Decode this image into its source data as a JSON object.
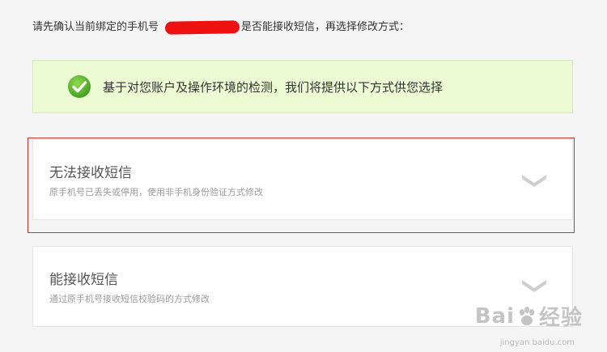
{
  "intro": {
    "before": "请先确认当前绑定的手机号",
    "after": "是否能接收短信，再选择修改方式："
  },
  "notice": {
    "icon": "check-circle-icon",
    "text": "基于对您账户及操作环境的检测，我们将提供以下方式供您选择"
  },
  "options": [
    {
      "title": "无法接收短信",
      "desc": "原手机号已丢失或停用，使用非手机身份验证方式修改",
      "icon": "chevron-down-icon"
    },
    {
      "title": "能接收短信",
      "desc": "通过原手机号接收短信校验码的方式修改",
      "icon": "chevron-down-icon"
    }
  ],
  "colors": {
    "notice_bg": "#ecfbd4",
    "check_green": "#5cb82e",
    "highlight_border": "#cc3333"
  },
  "watermark": {
    "brand_left": "Bai",
    "brand_right": "经验",
    "site": "jingyan.baidu.com"
  }
}
